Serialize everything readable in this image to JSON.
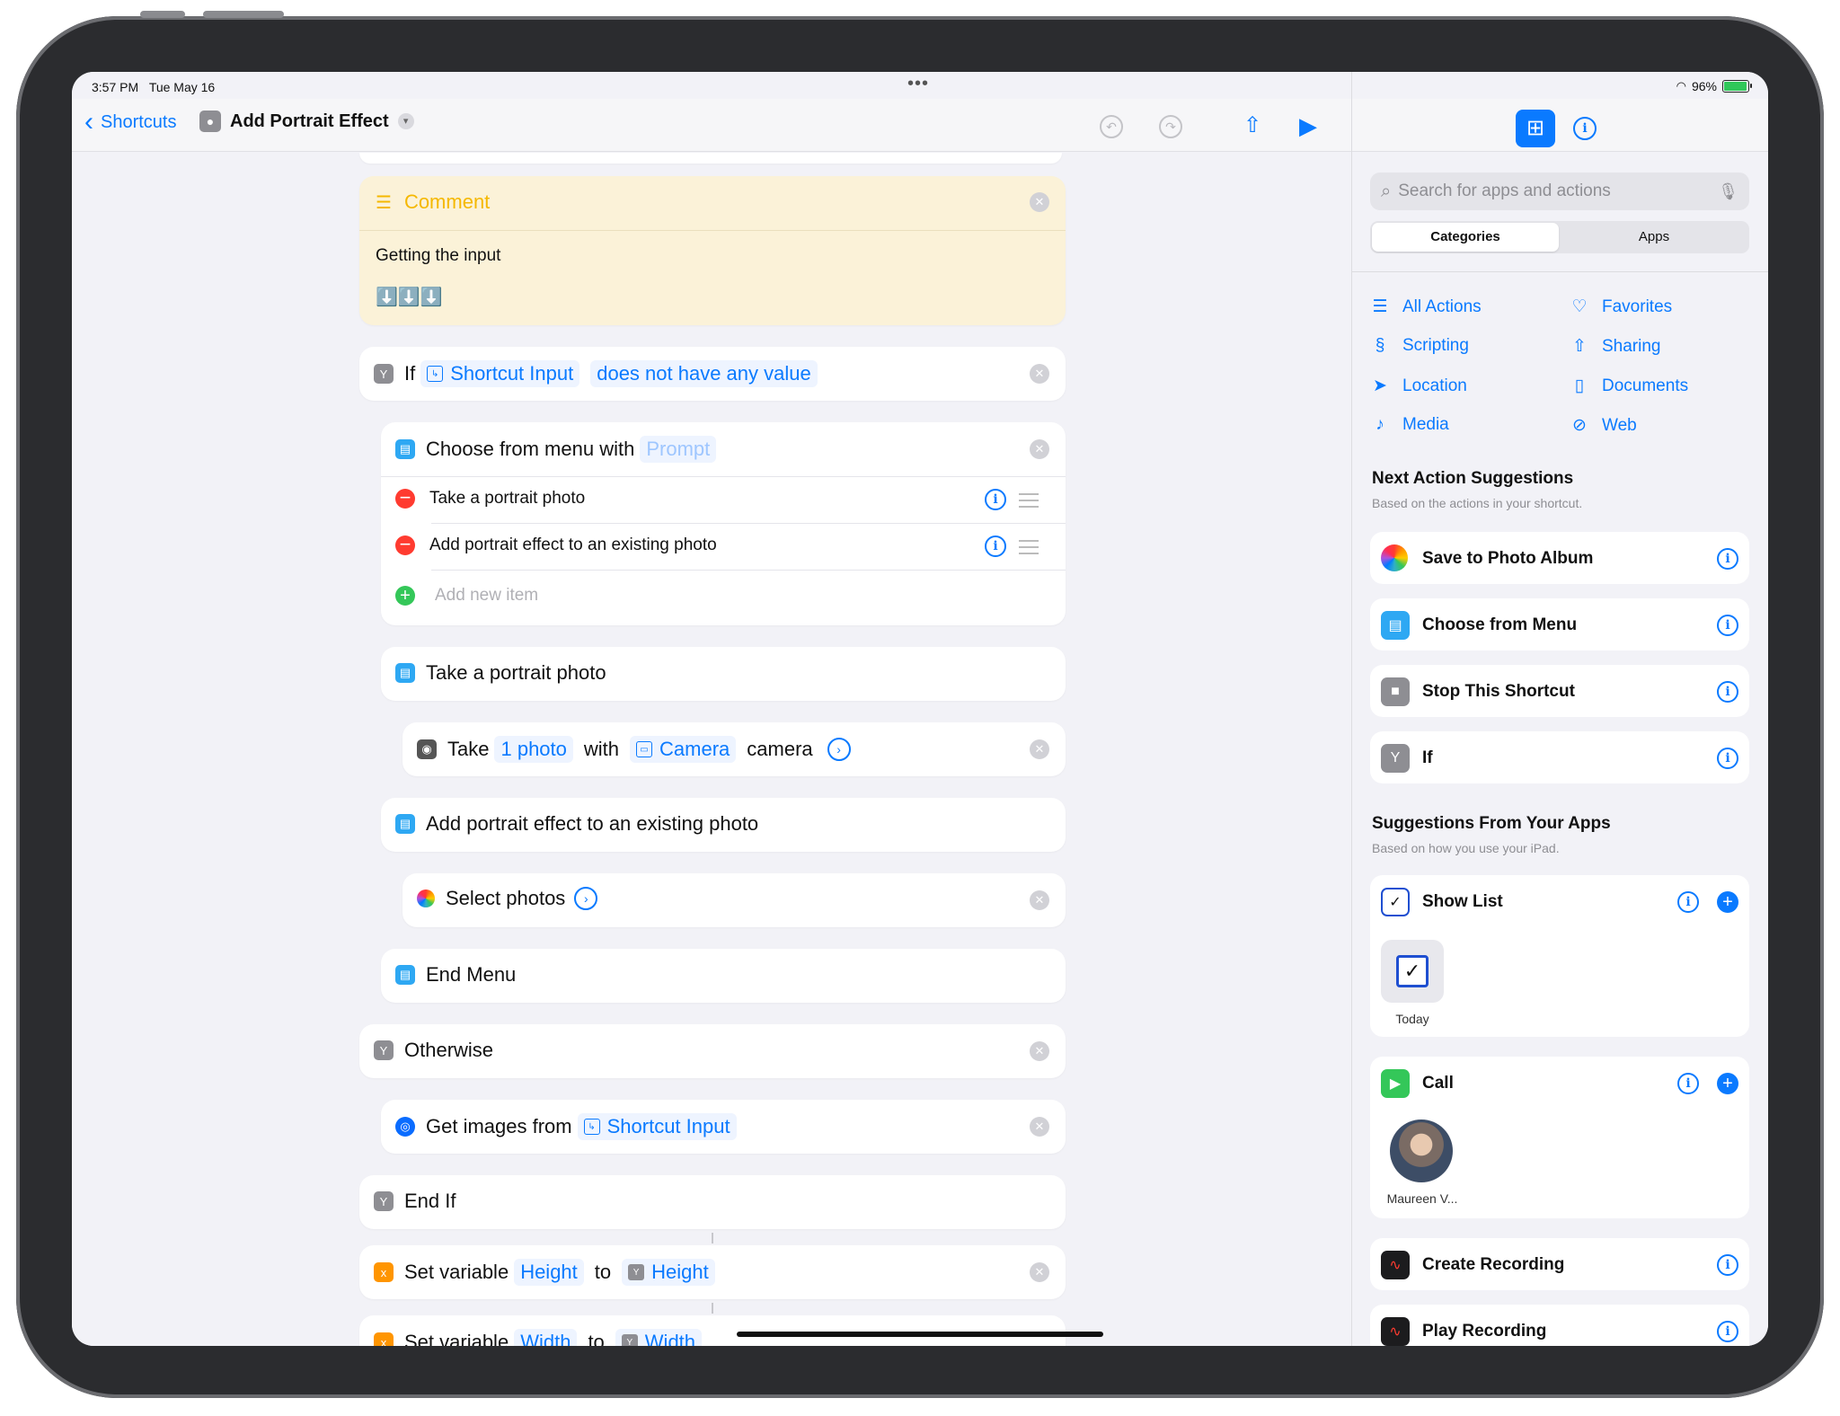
{
  "status": {
    "time": "3:57 PM",
    "date": "Tue May 16",
    "battery": "96%",
    "battery_level": 0.96
  },
  "nav": {
    "back_label": "Shortcuts",
    "title": "Add Portrait Effect"
  },
  "editor": {
    "comment": {
      "title": "Comment",
      "text": "Getting the input",
      "emoji": "⬇️⬇️⬇️"
    },
    "if_block": {
      "keyword": "If",
      "input": "Shortcut Input",
      "condition": "does not have any value"
    },
    "menu": {
      "label": "Choose from menu with",
      "prompt": "Prompt",
      "items": [
        "Take a portrait photo",
        "Add portrait effect to an existing photo"
      ],
      "add_new": "Add new item"
    },
    "case1": "Take a portrait photo",
    "take_photo": {
      "verb": "Take",
      "count": "1 photo",
      "with": "with",
      "camera": "Camera",
      "suffix": "camera"
    },
    "case2": "Add portrait effect to an existing photo",
    "select_photos": "Select photos",
    "end_menu": "End Menu",
    "otherwise": "Otherwise",
    "get_images": {
      "label": "Get images from",
      "input": "Shortcut Input"
    },
    "end_if": "End If",
    "set_height": {
      "label": "Set variable",
      "var": "Height",
      "to": "to",
      "value": "Height"
    },
    "set_width": {
      "label": "Set variable",
      "var": "Width",
      "to": "to",
      "value": "Width"
    }
  },
  "sidebar": {
    "search_placeholder": "Search for apps and actions",
    "segments": [
      "Categories",
      "Apps"
    ],
    "categories": [
      {
        "label": "All Actions",
        "icon": "list-icon"
      },
      {
        "label": "Favorites",
        "icon": "heart-icon"
      },
      {
        "label": "Scripting",
        "icon": "scripting-icon"
      },
      {
        "label": "Sharing",
        "icon": "share-icon"
      },
      {
        "label": "Location",
        "icon": "location-arrow-icon"
      },
      {
        "label": "Documents",
        "icon": "document-icon"
      },
      {
        "label": "Media",
        "icon": "music-note-icon"
      },
      {
        "label": "Web",
        "icon": "compass-icon"
      }
    ],
    "next_title": "Next Action Suggestions",
    "next_sub": "Based on the actions in your shortcut.",
    "next_items": [
      "Save to Photo Album",
      "Choose from Menu",
      "Stop This Shortcut",
      "If"
    ],
    "apps_title": "Suggestions From Your Apps",
    "apps_sub": "Based on how you use your iPad.",
    "show_list": {
      "label": "Show List",
      "tile": "Today"
    },
    "call": {
      "label": "Call",
      "contact": "Maureen V..."
    },
    "recordings": [
      "Create Recording",
      "Play Recording"
    ]
  },
  "colors": {
    "accent": "#0a7aff",
    "comment_bg": "#fbf2d8",
    "comment_title": "#f5b800"
  }
}
